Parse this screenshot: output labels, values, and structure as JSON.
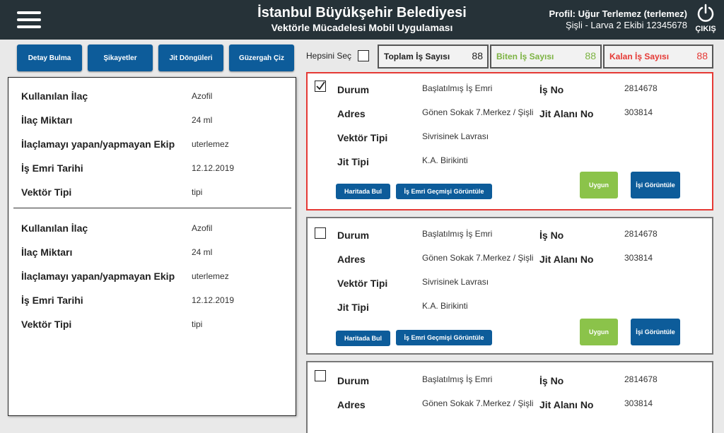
{
  "header": {
    "title": "İstanbul Büyükşehir Belediyesi",
    "subtitle": "Vektörle Mücadelesi Mobil Uygulaması",
    "profile_label": "Profil:",
    "profile_name": "Uğur Terlemez (terlemez)",
    "profile_team": "Şişli - Larva 2 Ekibi 12345678",
    "logout_label": "ÇIKIŞ"
  },
  "nav": {
    "detail": "Detay Bulma",
    "complaints": "Şikayetler",
    "cycles": "Jit Döngüleri",
    "route": "Güzergah Çiz"
  },
  "left_records": [
    {
      "drug_label": "Kullanılan İlaç",
      "drug": "Azofil",
      "amount_label": "İlaç Miktarı",
      "amount": "24 ml",
      "team_label": "İlaçlamayı yapan/yapmayan Ekip",
      "team": "uterlemez",
      "date_label": "İş Emri Tarihi",
      "date": "12.12.2019",
      "vector_label": "Vektör Tipi",
      "vector": "tipi"
    },
    {
      "drug_label": "Kullanılan İlaç",
      "drug": "Azofil",
      "amount_label": "İlaç Miktarı",
      "amount": "24 ml",
      "team_label": "İlaçlamayı yapan/yapmayan Ekip",
      "team": "uterlemez",
      "date_label": "İş Emri Tarihi",
      "date": "12.12.2019",
      "vector_label": "Vektör Tipi",
      "vector": "tipi"
    }
  ],
  "select_all_label": "Hepsini Seç",
  "stats": {
    "total_label": "Toplam İş Sayısı",
    "total": "88",
    "done_label": "Biten İş Sayısı",
    "done": "88",
    "left_label": "Kalan İş Sayısı",
    "left": "88"
  },
  "colors": {
    "accent": "#0d5c9a",
    "ok": "#8bc34a",
    "done": "#7cb342",
    "remaining": "#e53935"
  },
  "cards": [
    {
      "checked": true,
      "status_label": "Durum",
      "status": "Başlatılmış İş Emri",
      "addr_label": "Adres",
      "addr": "Gönen Sokak 7.Merkez / Şişli",
      "vector_label": "Vektör Tipi",
      "vector": "Sivrisinek Lavrası",
      "jit_label": "Jit Tipi",
      "jit": "K.A. Birikinti",
      "no_label": "İş No",
      "no": "2814678",
      "area_label": "Jit Alanı No",
      "area": "303814",
      "map_btn": "Haritada Bul",
      "history_btn": "İş Emri Geçmişi Görüntüle",
      "ok_btn": "Uygun",
      "view_btn": "İşi Görüntüle"
    },
    {
      "checked": false,
      "status_label": "Durum",
      "status": "Başlatılmış İş Emri",
      "addr_label": "Adres",
      "addr": "Gönen Sokak 7.Merkez / Şişli",
      "vector_label": "Vektör Tipi",
      "vector": "Sivrisinek Lavrası",
      "jit_label": "Jit Tipi",
      "jit": "K.A. Birikinti",
      "no_label": "İş No",
      "no": "2814678",
      "area_label": "Jit Alanı No",
      "area": "303814",
      "map_btn": "Haritada Bul",
      "history_btn": "İş Emri Geçmişi Görüntüle",
      "ok_btn": "Uygun",
      "view_btn": "İşi Görüntüle"
    },
    {
      "checked": false,
      "status_label": "Durum",
      "status": "Başlatılmış İş Emri",
      "addr_label": "Adres",
      "addr": "Gönen Sokak 7.Merkez / Şişli",
      "no_label": "İş No",
      "no": "2814678",
      "area_label": "Jit Alanı No",
      "area": "303814"
    }
  ]
}
